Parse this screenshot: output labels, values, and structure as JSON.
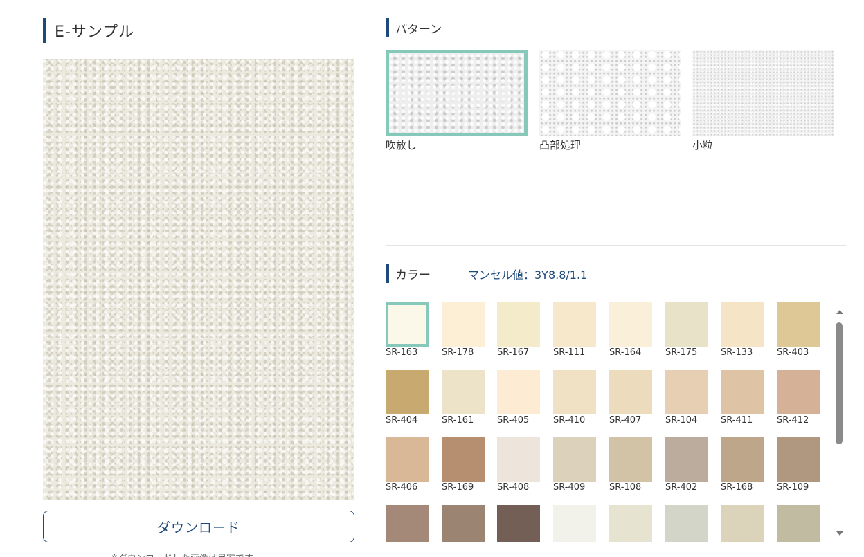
{
  "sample": {
    "title": "E-サンプル",
    "download_label": "ダウンロード",
    "note": "※ダウンロードした画像は目安です。"
  },
  "pattern": {
    "title": "パターン",
    "items": [
      {
        "label": "吹放し",
        "selected": true
      },
      {
        "label": "凸部処理",
        "selected": false
      },
      {
        "label": "小粒",
        "selected": false
      }
    ]
  },
  "color": {
    "title": "カラー",
    "munsell": "マンセル値：3Y8.8/1.1",
    "swatches": [
      {
        "code": "SR-163",
        "hex": "#fbf8ea",
        "selected": true
      },
      {
        "code": "SR-178",
        "hex": "#fdefd6"
      },
      {
        "code": "SR-167",
        "hex": "#f4ebcb"
      },
      {
        "code": "SR-111",
        "hex": "#f7e8cb"
      },
      {
        "code": "SR-164",
        "hex": "#faf0d9"
      },
      {
        "code": "SR-175",
        "hex": "#e8e2c8"
      },
      {
        "code": "SR-133",
        "hex": "#f6e4c7"
      },
      {
        "code": "SR-403",
        "hex": "#ddc896"
      },
      {
        "code": "SR-404",
        "hex": "#c8a96f"
      },
      {
        "code": "SR-161",
        "hex": "#ede3c9"
      },
      {
        "code": "SR-405",
        "hex": "#fdebd3"
      },
      {
        "code": "SR-410",
        "hex": "#f0e0c4"
      },
      {
        "code": "SR-407",
        "hex": "#ecdcbd"
      },
      {
        "code": "SR-104",
        "hex": "#e6cfb3"
      },
      {
        "code": "SR-411",
        "hex": "#dfc3a5"
      },
      {
        "code": "SR-412",
        "hex": "#d5b297"
      },
      {
        "code": "SR-406",
        "hex": "#d9b897"
      },
      {
        "code": "SR-169",
        "hex": "#b58f70"
      },
      {
        "code": "SR-408",
        "hex": "#ede5dc"
      },
      {
        "code": "SR-409",
        "hex": "#dcd1bb"
      },
      {
        "code": "SR-108",
        "hex": "#d2c3a7"
      },
      {
        "code": "SR-402",
        "hex": "#bcac9d"
      },
      {
        "code": "SR-168",
        "hex": "#bea68b"
      },
      {
        "code": "SR-109",
        "hex": "#af9780"
      },
      {
        "code": "",
        "hex": "#a48878"
      },
      {
        "code": "",
        "hex": "#9c8472"
      },
      {
        "code": "",
        "hex": "#735f55"
      },
      {
        "code": "",
        "hex": "#f3f2ea"
      },
      {
        "code": "",
        "hex": "#e7e3d1"
      },
      {
        "code": "",
        "hex": "#d3d5c8"
      },
      {
        "code": "",
        "hex": "#dcd3bb"
      },
      {
        "code": "",
        "hex": "#c0bba1"
      }
    ]
  }
}
